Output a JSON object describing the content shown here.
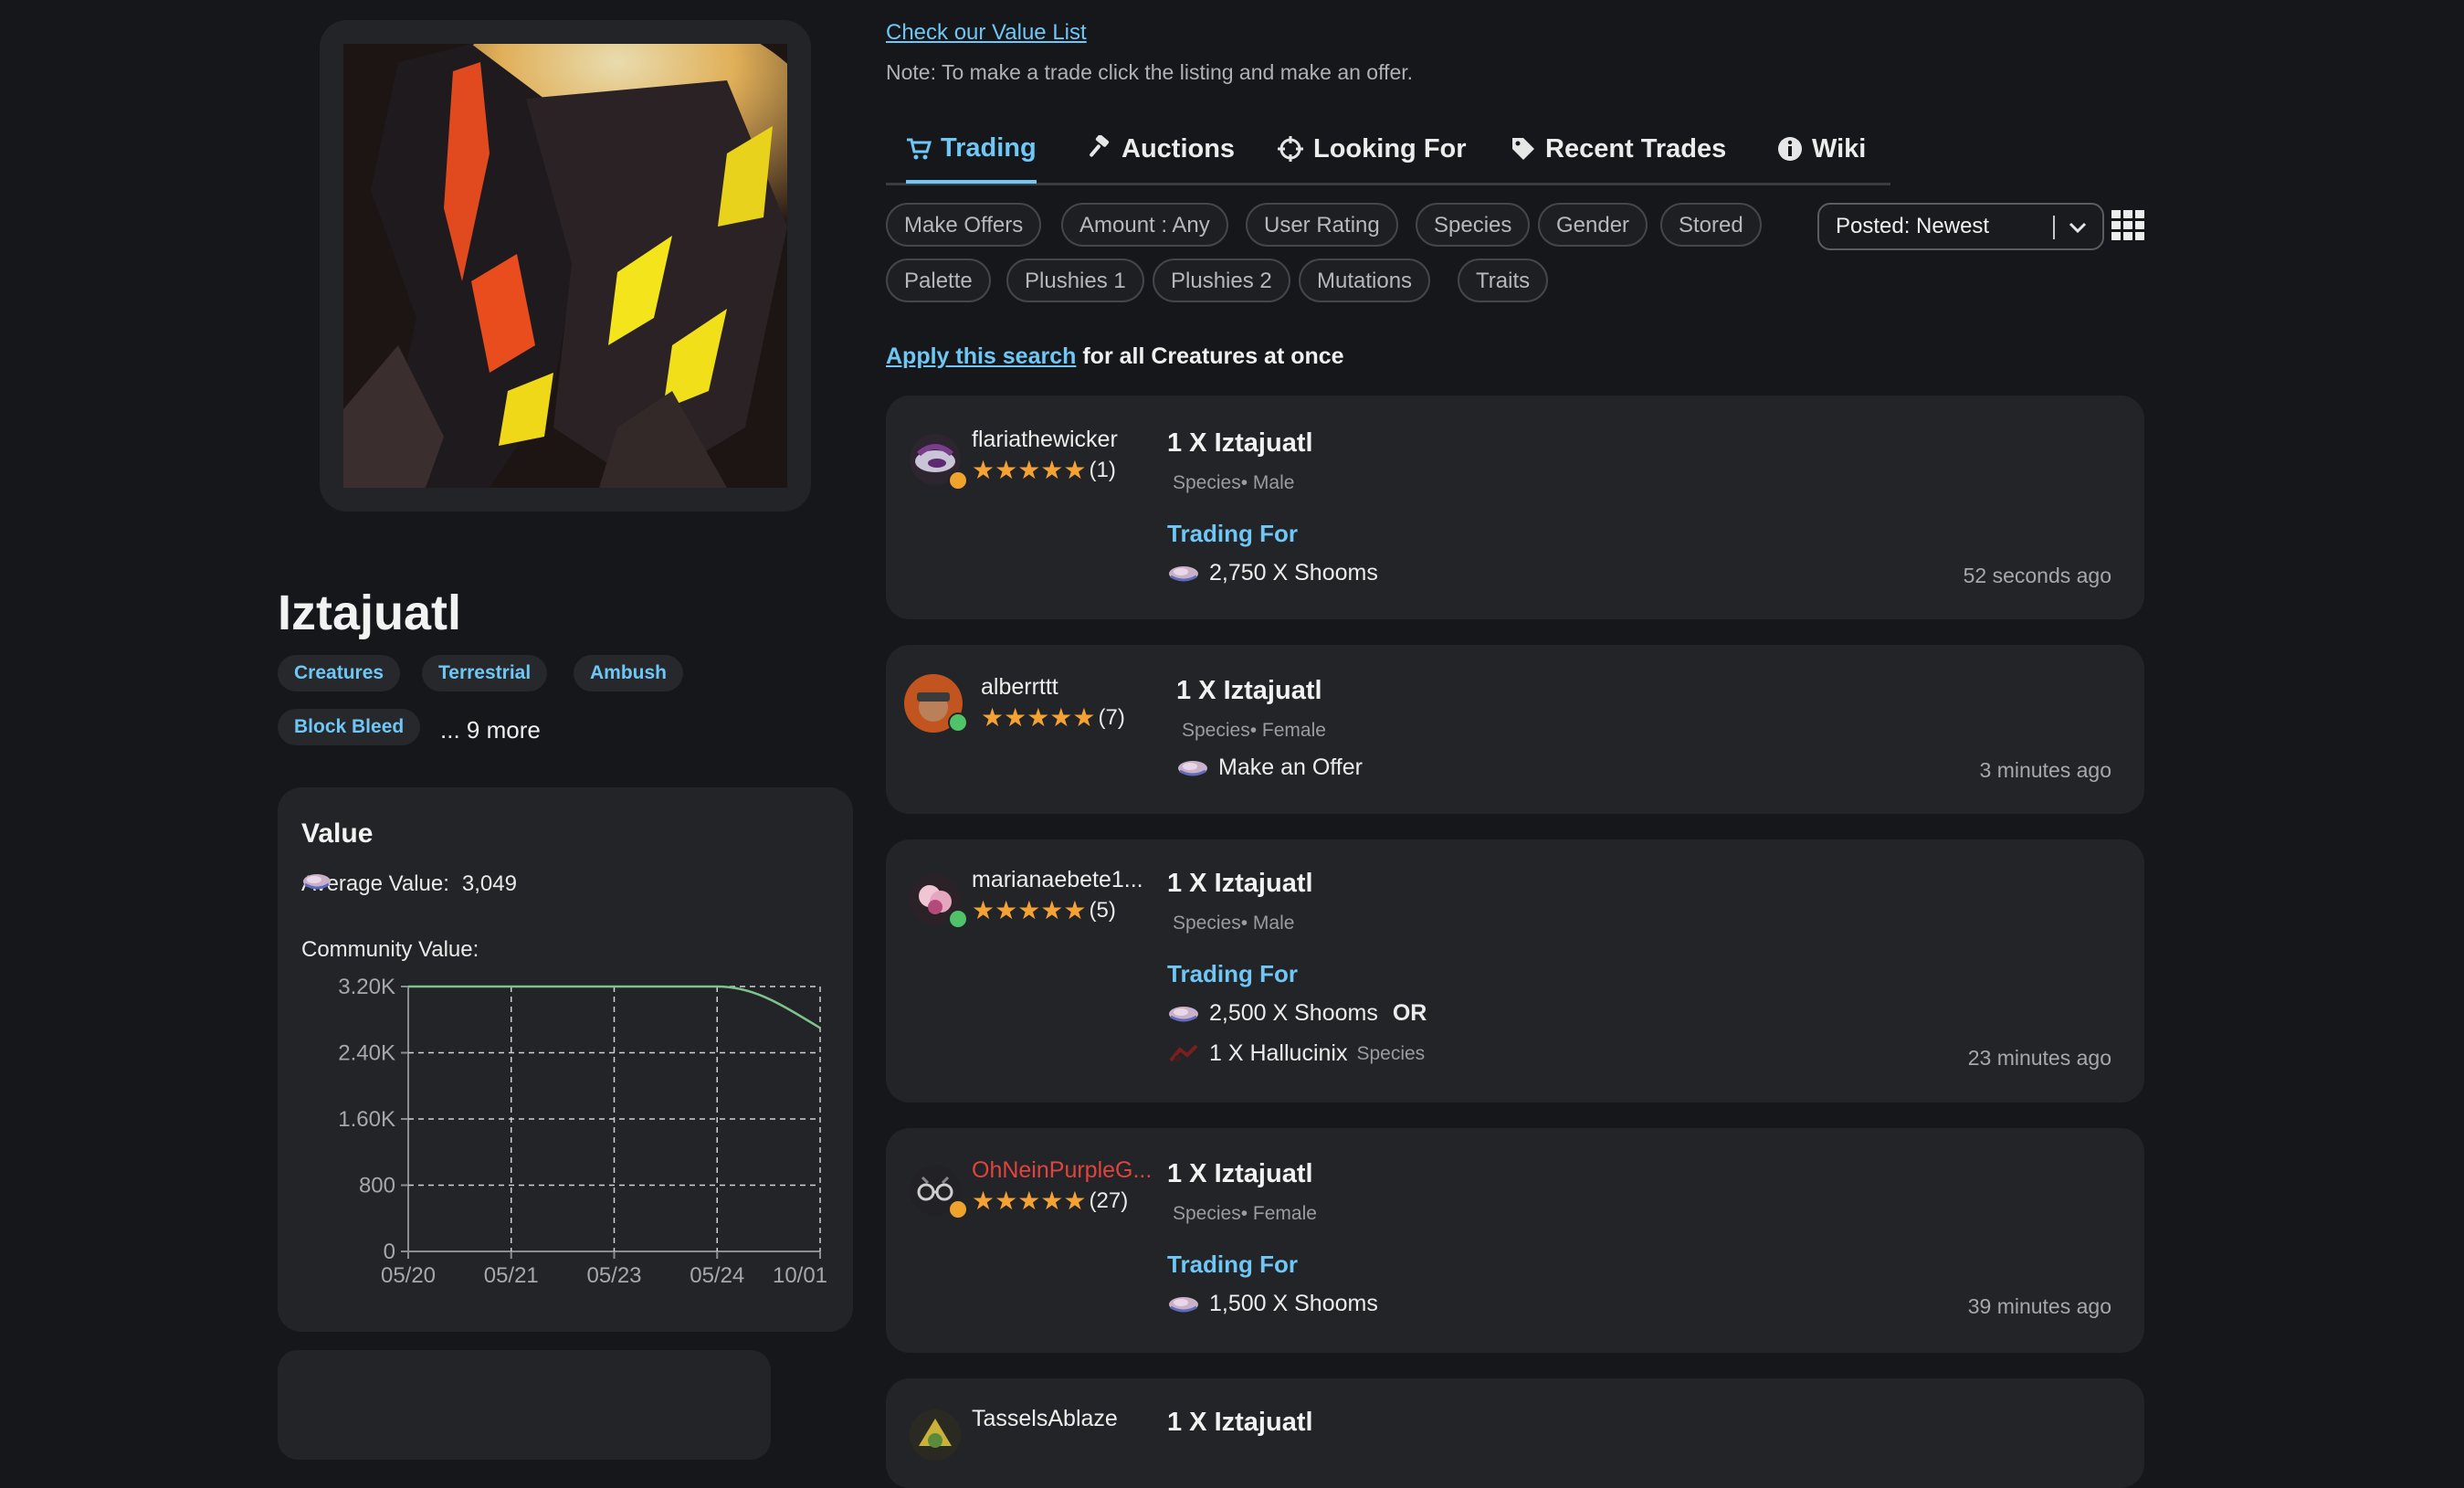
{
  "creature": {
    "name": "Iztajuatl",
    "tags": [
      "Creatures",
      "Terrestrial",
      "Ambush",
      "Block Bleed"
    ],
    "more_tags": "... 9 more"
  },
  "value": {
    "heading": "Value",
    "average_label": "Average Value:",
    "average_value": "3,049",
    "community_label": "Community Value:"
  },
  "chart_data": {
    "type": "line",
    "x": [
      "05/20",
      "05/21",
      "05/23",
      "05/24",
      "10/01"
    ],
    "series": [
      {
        "values": [
          3200,
          3200,
          3200,
          3200,
          2700
        ]
      }
    ],
    "y_ticks": [
      "0",
      "800",
      "1.60K",
      "2.40K",
      "3.20K"
    ],
    "ylim": [
      0,
      3200
    ],
    "grid": true,
    "line_color": "#7fc28a"
  },
  "header": {
    "value_list_link": "Check our Value List",
    "note": "Note: To make a trade click the listing and make an offer."
  },
  "tabs": [
    {
      "label": "Trading",
      "icon": "cart-icon",
      "active": true
    },
    {
      "label": "Auctions",
      "icon": "gavel-icon"
    },
    {
      "label": "Looking For",
      "icon": "crosshair-icon"
    },
    {
      "label": "Recent Trades",
      "icon": "tag-icon"
    },
    {
      "label": "Wiki",
      "icon": "info-icon"
    }
  ],
  "filters": {
    "row1": [
      "Make Offers",
      "Amount : Any",
      "User Rating",
      "Species",
      "Gender",
      "Stored"
    ],
    "row2": [
      "Palette",
      "Plushies 1",
      "Plushies 2",
      "Mutations",
      "Traits"
    ],
    "sort": "Posted: Newest"
  },
  "apply": {
    "link": "Apply this search",
    "rest": "for all Creatures at once"
  },
  "listings": [
    {
      "user": "flariathewicker",
      "user_color": "#eeeeee",
      "rating": "(1)",
      "status": "away",
      "title": "1 X Iztajuatl",
      "meta": "Species• Male",
      "trading_for": "Trading For",
      "wants": [
        {
          "text": "2,750 X Shooms"
        }
      ],
      "time": "52 seconds ago"
    },
    {
      "user": "alberrttt",
      "user_color": "#eeeeee",
      "rating": "(7)",
      "status": "online",
      "title": "1 X Iztajuatl",
      "meta": "Species• Female",
      "wants": [
        {
          "text": "Make an Offer"
        }
      ],
      "time": "3 minutes ago"
    },
    {
      "user": "marianaebete1...",
      "user_color": "#eeeeee",
      "rating": "(5)",
      "status": "online",
      "title": "1 X Iztajuatl",
      "meta": "Species• Male",
      "trading_for": "Trading For",
      "wants": [
        {
          "text": "2,500 X Shooms",
          "or": "OR"
        },
        {
          "text": "1 X Hallucinix",
          "sub": "Species"
        }
      ],
      "time": "23 minutes ago"
    },
    {
      "user": "OhNeinPurpleG...",
      "user_color": "#e0443e",
      "rating": "(27)",
      "status": "away",
      "title": "1 X Iztajuatl",
      "meta": "Species• Female",
      "trading_for": "Trading For",
      "wants": [
        {
          "text": "1,500 X Shooms"
        }
      ],
      "time": "39 minutes ago"
    },
    {
      "user": "TasselsAblaze",
      "title": "1 X Iztajuatl"
    }
  ]
}
